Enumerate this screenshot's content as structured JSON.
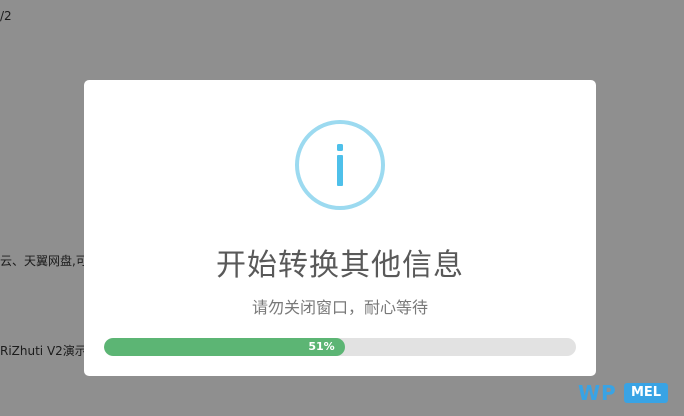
{
  "background": {
    "line1": "/2",
    "line2": "云、天翼网盘,可",
    "line3": "RiZhuti V2演示"
  },
  "modal": {
    "icon": "info-icon",
    "icon_glyph": "i",
    "title": "开始转换其他信息",
    "subtitle": "请勿关闭窗口，耐心等待",
    "progress": {
      "percent": 51,
      "label": "51%"
    },
    "colors": {
      "icon_ring": "#9cdaf0",
      "icon_glyph": "#4ec0ea",
      "progress_fill": "#5cb574",
      "progress_track": "#e2e2e2"
    }
  },
  "watermark": {
    "brand_left": "WP",
    "brand_right": "MEL",
    "color": "#39a3e4"
  }
}
